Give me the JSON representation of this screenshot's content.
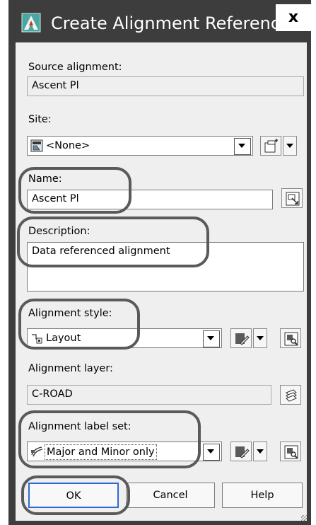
{
  "window": {
    "title": "Create Alignment Reference",
    "close_label": "x"
  },
  "source_alignment": {
    "label": "Source alignment:",
    "value": "Ascent Pl"
  },
  "site": {
    "label": "Site:",
    "value": "<None>"
  },
  "name": {
    "label": "Name:",
    "value": "Ascent Pl"
  },
  "description": {
    "label": "Description:",
    "value": "Data referenced alignment"
  },
  "alignment_style": {
    "label": "Alignment style:",
    "value": "Layout"
  },
  "alignment_layer": {
    "label": "Alignment layer:",
    "value": "C-ROAD"
  },
  "alignment_label_set": {
    "label": "Alignment label set:",
    "value": "Major and Minor only"
  },
  "buttons": {
    "ok": "OK",
    "cancel": "Cancel",
    "help": "Help"
  },
  "colors": {
    "frame": "#3d3d3d",
    "client": "#efefef",
    "highlight_oval": "#5a5a5a",
    "default_button_border": "#2d6bd0"
  }
}
